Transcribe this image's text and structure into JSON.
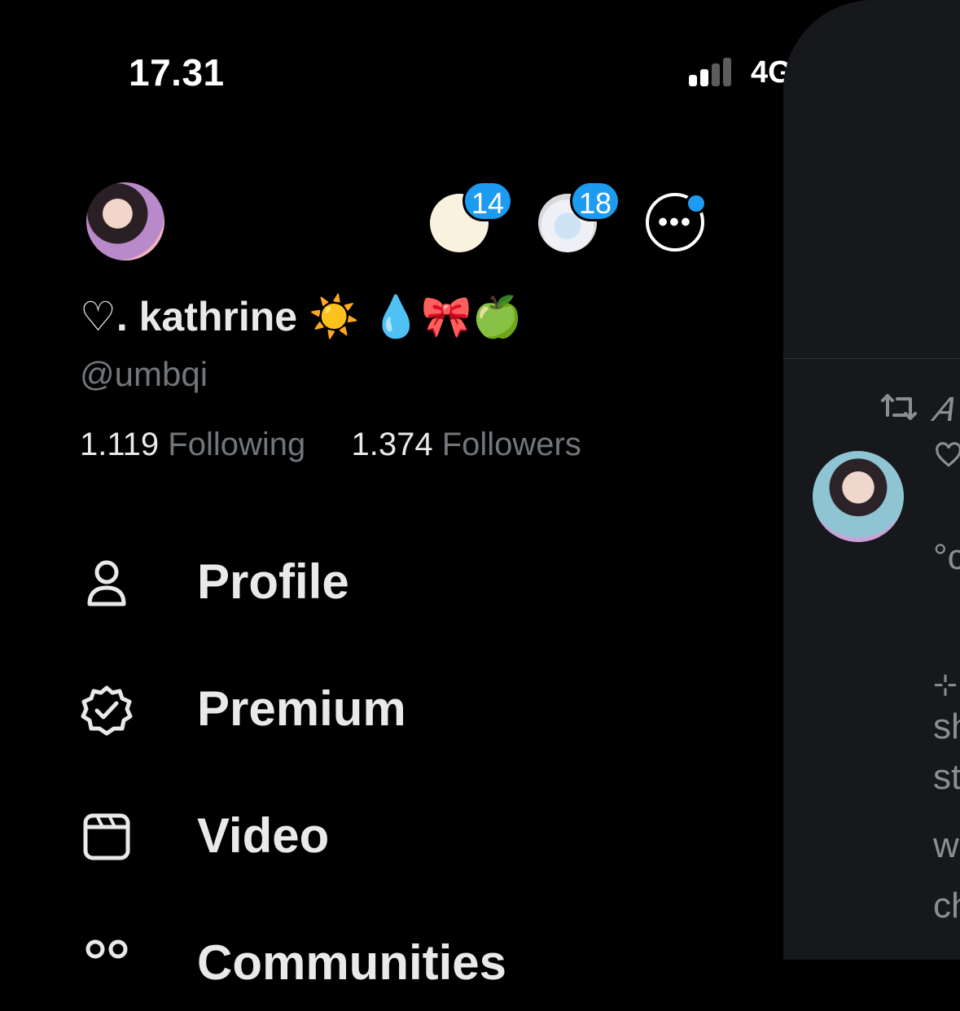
{
  "status_bar": {
    "time": "17.31",
    "network": "4G"
  },
  "header": {
    "badge_1": "14",
    "badge_2": "18"
  },
  "profile": {
    "display_name": "♡. kathrine ☀️ 💧🎀🍏",
    "handle": "@umbqi",
    "following_count": "1.119",
    "following_label": "Following",
    "followers_count": "1.374",
    "followers_label": "Followers"
  },
  "menu": {
    "items": [
      {
        "label": "Profile",
        "icon": "person-icon"
      },
      {
        "label": "Premium",
        "icon": "verified-badge-icon"
      },
      {
        "label": "Video",
        "icon": "video-icon"
      },
      {
        "label": "Communities",
        "icon": "communities-icon"
      }
    ]
  },
  "background_panel": {
    "fragments": [
      "𝐴",
      "°c",
      "⊹",
      "sh",
      "st",
      "w",
      "ch"
    ]
  },
  "colors": {
    "accent": "#1d9bf0",
    "background": "#000000",
    "text_primary": "#e7e9ea",
    "text_secondary": "#71767b"
  }
}
